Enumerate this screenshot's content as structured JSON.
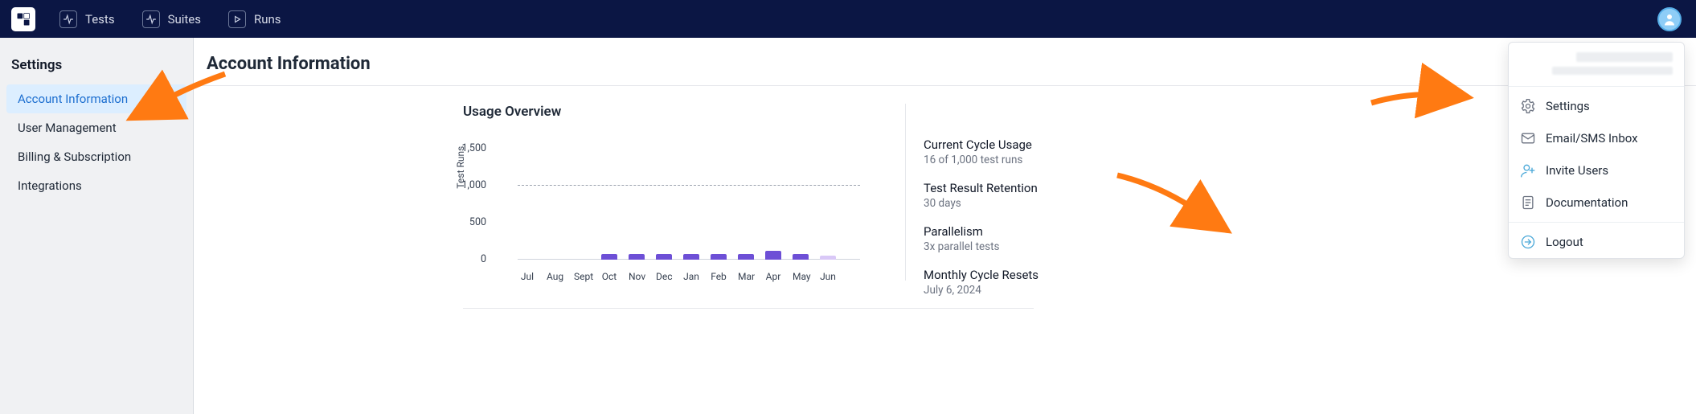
{
  "nav": {
    "tests": "Tests",
    "suites": "Suites",
    "runs": "Runs"
  },
  "sidebar": {
    "title": "Settings",
    "items": [
      {
        "label": "Account Information",
        "active": true
      },
      {
        "label": "User Management",
        "active": false
      },
      {
        "label": "Billing & Subscription",
        "active": false
      },
      {
        "label": "Integrations",
        "active": false
      }
    ]
  },
  "page": {
    "title": "Account Information"
  },
  "usage": {
    "title": "Usage Overview",
    "ylabel": "Test Runs",
    "stats": {
      "cycle_title": "Current Cycle Usage",
      "cycle_sub": "16 of 1,000 test runs",
      "retention_title": "Test Result Retention",
      "retention_sub": "30 days",
      "parallel_title": "Parallelism",
      "parallel_sub": "3x parallel tests",
      "reset_title": "Monthly Cycle Resets",
      "reset_sub": "July 6, 2024"
    }
  },
  "user_menu": {
    "settings": "Settings",
    "inbox": "Email/SMS Inbox",
    "invite": "Invite Users",
    "docs": "Documentation",
    "logout": "Logout"
  },
  "chart_data": {
    "type": "bar",
    "title": "Usage Overview",
    "ylabel": "Test Runs",
    "xlabel": "",
    "yticks": [
      0,
      500,
      1000,
      1500
    ],
    "ylim": [
      0,
      1500
    ],
    "threshold_line": 1000,
    "categories": [
      "Jul",
      "Aug",
      "Sept",
      "Oct",
      "Nov",
      "Dec",
      "Jan",
      "Feb",
      "Mar",
      "Apr",
      "May",
      "Jun"
    ],
    "values": [
      0,
      0,
      0,
      80,
      80,
      80,
      80,
      80,
      80,
      120,
      80,
      50
    ],
    "bar_colors": [
      "#6d4fd6",
      "#6d4fd6",
      "#6d4fd6",
      "#6d4fd6",
      "#6d4fd6",
      "#6d4fd6",
      "#6d4fd6",
      "#6d4fd6",
      "#6d4fd6",
      "#6d4fd6",
      "#6d4fd6",
      "#d9c8f7"
    ]
  },
  "colors": {
    "navbar": "#0b1644",
    "accent": "#1d6fd0",
    "arrow": "#ff7a12"
  }
}
